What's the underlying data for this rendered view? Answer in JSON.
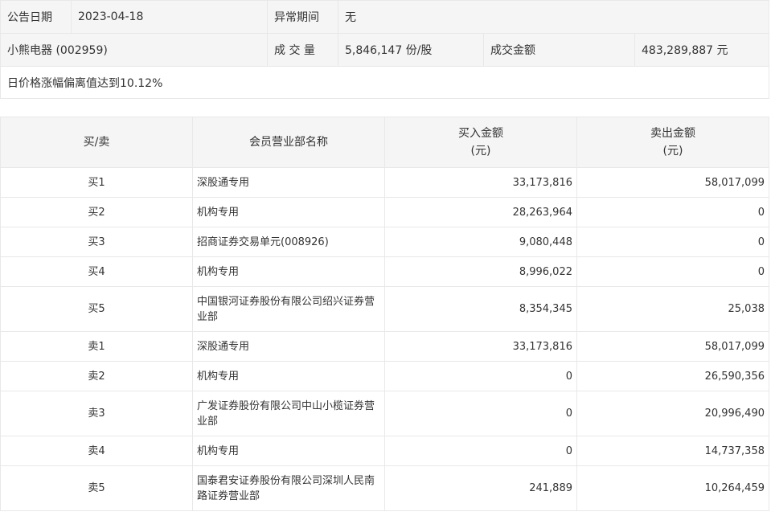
{
  "info": {
    "date_label": "公告日期",
    "date_value": "2023-04-18",
    "period_label": "异常期间",
    "period_value": "无",
    "stock_name": "小熊电器 (002959)",
    "volume_label": "成 交 量",
    "volume_value": "5,846,147 份/股",
    "amount_label": "成交金额",
    "amount_value": "483,289,887 元",
    "reason": "日价格涨幅偏离值达到10.12%"
  },
  "table": {
    "headers": {
      "direction": "买/卖",
      "branch": "会员营业部名称",
      "buy_line1": "买入金额",
      "buy_line2": "(元)",
      "sell_line1": "卖出金额",
      "sell_line2": "(元)"
    },
    "rows": [
      {
        "direction": "买1",
        "branch": "深股通专用",
        "buy": "33,173,816",
        "sell": "58,017,099"
      },
      {
        "direction": "买2",
        "branch": "机构专用",
        "buy": "28,263,964",
        "sell": "0"
      },
      {
        "direction": "买3",
        "branch": "招商证券交易单元(008926)",
        "buy": "9,080,448",
        "sell": "0"
      },
      {
        "direction": "买4",
        "branch": "机构专用",
        "buy": "8,996,022",
        "sell": "0"
      },
      {
        "direction": "买5",
        "branch": "中国银河证券股份有限公司绍兴证券营业部",
        "buy": "8,354,345",
        "sell": "25,038"
      },
      {
        "direction": "卖1",
        "branch": "深股通专用",
        "buy": "33,173,816",
        "sell": "58,017,099"
      },
      {
        "direction": "卖2",
        "branch": "机构专用",
        "buy": "0",
        "sell": "26,590,356"
      },
      {
        "direction": "卖3",
        "branch": "广发证券股份有限公司中山小榄证券营业部",
        "buy": "0",
        "sell": "20,996,490"
      },
      {
        "direction": "卖4",
        "branch": "机构专用",
        "buy": "0",
        "sell": "14,737,358"
      },
      {
        "direction": "卖5",
        "branch": "国泰君安证券股份有限公司深圳人民南路证券营业部",
        "buy": "241,889",
        "sell": "10,264,459"
      }
    ]
  }
}
